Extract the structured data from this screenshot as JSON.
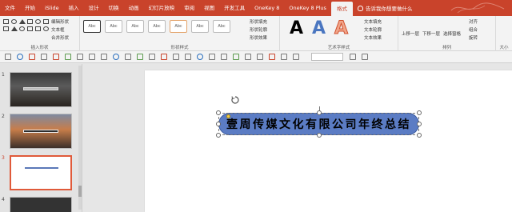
{
  "tabs": [
    "文件",
    "开始",
    "iSlide",
    "插入",
    "设计",
    "切换",
    "动画",
    "幻灯片放映",
    "审阅",
    "视图",
    "开发工具",
    "OneKey 8",
    "OneKey 8 Plus",
    "格式"
  ],
  "active_tab_index": 13,
  "tell_me": "告诉我你想要做什么",
  "ribbon": {
    "insert_shapes": {
      "label": "插入形状",
      "edit_shape": "编辑形状",
      "text_box": "文本框",
      "merge_shapes": "合并形状"
    },
    "shape_styles": {
      "label": "形状样式",
      "sample": "Abc",
      "fill": "形状填充",
      "outline": "形状轮廓",
      "effects": "形状效果"
    },
    "wordart": {
      "label": "艺术字样式",
      "sample": "A",
      "text_fill": "文本填充",
      "text_outline": "文本轮廓",
      "text_effects": "文本效果"
    },
    "arrange": {
      "label": "排列",
      "bring_forward": "上移一层",
      "send_backward": "下移一层",
      "selection_pane": "选择窗格",
      "align": "对齐",
      "group": "组合",
      "rotate": "旋转"
    },
    "size_label": "大小"
  },
  "thumbnails": [
    {
      "number": "1",
      "selected": false
    },
    {
      "number": "2",
      "selected": false
    },
    {
      "number": "3",
      "selected": true
    },
    {
      "number": "4",
      "selected": false
    }
  ],
  "slide": {
    "banner_text": "壹周传媒文化有限公司年终总结"
  },
  "colors": {
    "accent": "#c9432b",
    "banner_fill": "#5b7cc4"
  }
}
